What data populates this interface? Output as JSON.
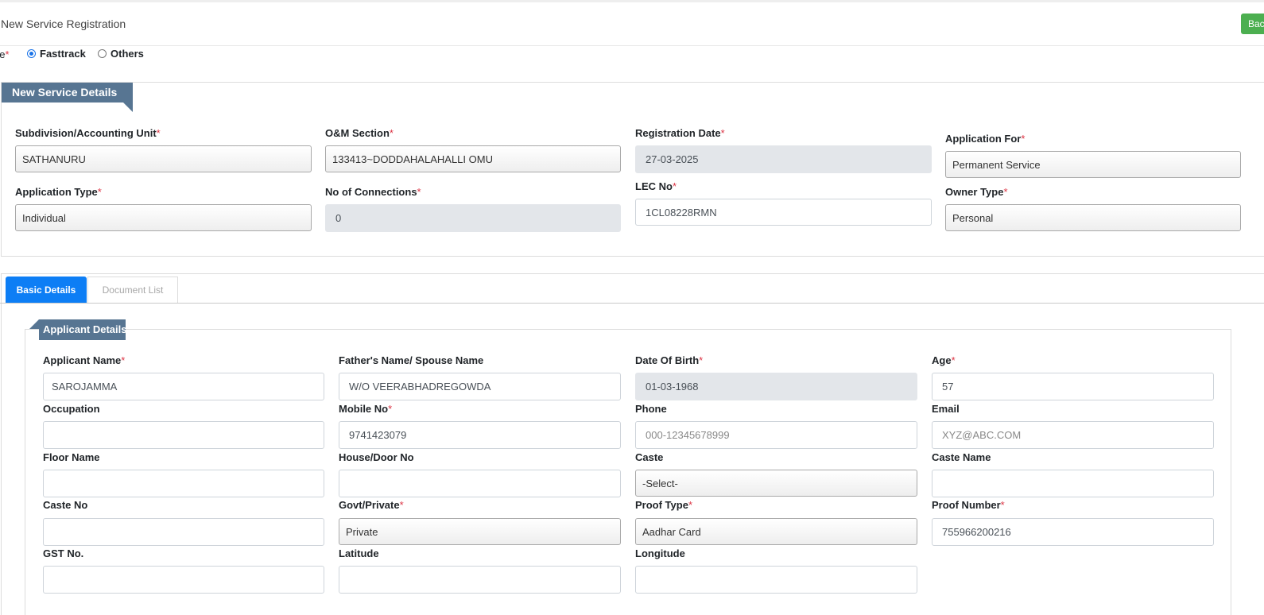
{
  "header": {
    "title": "New Service Registration",
    "back_label": "Back"
  },
  "service_type": {
    "label_fragment": "pe",
    "options": [
      {
        "label": "Fasttrack",
        "selected": true
      },
      {
        "label": "Others",
        "selected": false
      }
    ]
  },
  "service_details": {
    "heading": "New Service Details",
    "subdivision": {
      "label": "Subdivision/Accounting Unit",
      "value": "SATHANURU"
    },
    "om_section": {
      "label": "O&M Section",
      "value": "133413~DODDAHALAHALLI OMU"
    },
    "registration_date": {
      "label": "Registration Date",
      "value": "27-03-2025"
    },
    "application_for": {
      "label": "Application For",
      "value": "Permanent Service"
    },
    "application_type": {
      "label": "Application Type",
      "value": "Individual"
    },
    "no_of_connections": {
      "label": "No of Connections",
      "value": "0"
    },
    "lec_no": {
      "label": "LEC No",
      "value": "1CL08228RMN"
    },
    "owner_type": {
      "label": "Owner Type",
      "value": "Personal"
    }
  },
  "tabs": [
    {
      "label": "Basic Details",
      "active": true
    },
    {
      "label": "Document List",
      "active": false
    }
  ],
  "applicant": {
    "heading": "Applicant Details",
    "name": {
      "label": "Applicant Name",
      "value": "SAROJAMMA"
    },
    "father_spouse": {
      "label": "Father's Name/ Spouse Name",
      "value": "W/O VEERABHADREGOWDA"
    },
    "dob": {
      "label": "Date Of Birth",
      "value": "01-03-1968"
    },
    "age": {
      "label": "Age",
      "value": "57"
    },
    "occupation": {
      "label": "Occupation",
      "value": ""
    },
    "mobile": {
      "label": "Mobile No",
      "value": "9741423079"
    },
    "phone": {
      "label": "Phone",
      "placeholder": "000-12345678999"
    },
    "email": {
      "label": "Email",
      "placeholder": "XYZ@ABC.COM"
    },
    "floor_name": {
      "label": "Floor Name",
      "value": ""
    },
    "house_no": {
      "label": "House/Door No",
      "value": ""
    },
    "caste": {
      "label": "Caste",
      "value": "-Select-"
    },
    "caste_name": {
      "label": "Caste Name",
      "value": ""
    },
    "caste_no": {
      "label": "Caste No",
      "value": ""
    },
    "govt_private": {
      "label": "Govt/Private",
      "value": "Private"
    },
    "proof_type": {
      "label": "Proof Type",
      "value": "Aadhar Card"
    },
    "proof_number": {
      "label": "Proof Number",
      "value": "755966200216"
    },
    "gst_no": {
      "label": "GST No.",
      "value": ""
    },
    "latitude": {
      "label": "Latitude",
      "value": ""
    },
    "longitude": {
      "label": "Longitude",
      "value": ""
    }
  },
  "colors": {
    "ribbon": "#577592",
    "active_tab": "#0d7ef5",
    "back_button": "#4caf50",
    "required_mark": "#dc3545"
  }
}
